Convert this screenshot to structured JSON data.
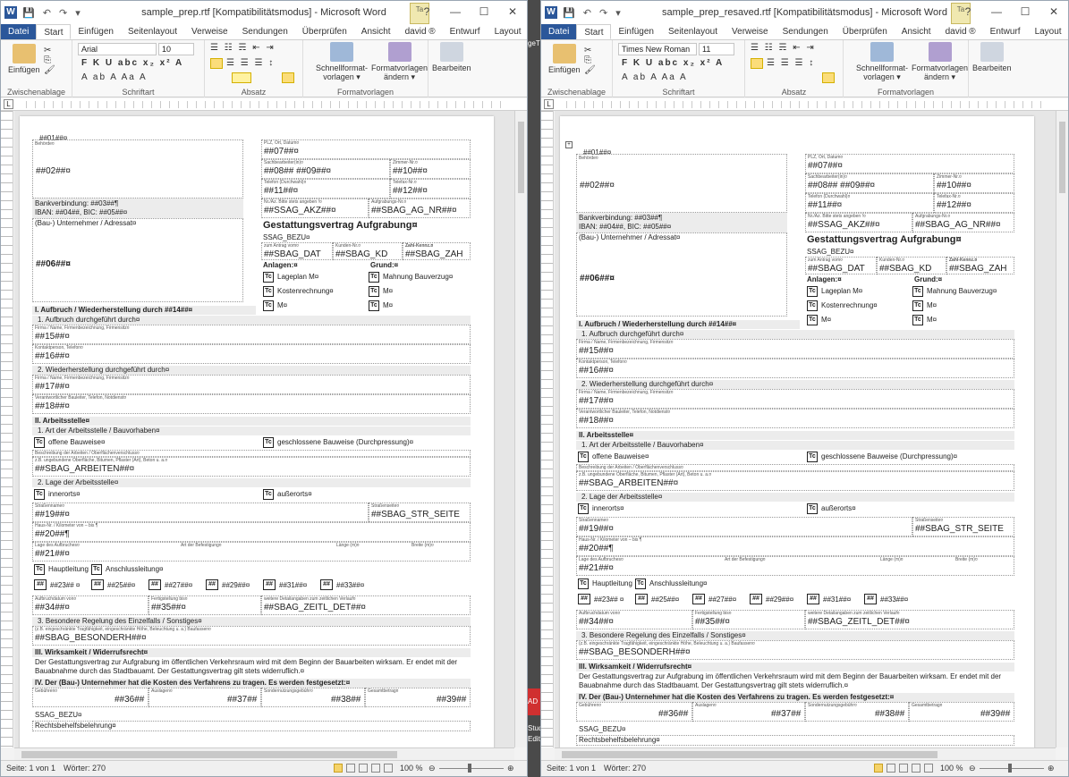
{
  "left": {
    "title": "sample_prep.rtf [Kompatibilitätsmodus]  -  Microsoft Word",
    "font_name": "Arial",
    "font_size": "10",
    "zoom": "100 %"
  },
  "right": {
    "title": "sample_prep_resaved.rtf [Kompatibilitätsmodus]  -  Microsoft Word",
    "font_name": "Times New Roman",
    "font_size": "11",
    "zoom": "100 %"
  },
  "ribbon": {
    "tabs": [
      "Datei",
      "Start",
      "Einfügen",
      "Seitenlayout",
      "Verweise",
      "Sendungen",
      "Überprüfen",
      "Ansicht",
      "david ®",
      "Entwurf",
      "Layout"
    ],
    "paste": "Einfügen",
    "styles_quick": "Schnellformat-\nvorlagen ▾",
    "styles_change": "Formatvorlagen\nändern ▾",
    "edit": "Bearbeiten",
    "groups": {
      "clipboard": "Zwischenablage",
      "font": "Schriftart",
      "paragraph": "Absatz",
      "styles": "Formatvorlagen"
    },
    "context_tab": "Ta"
  },
  "status": {
    "page": "Seite: 1 von 1",
    "words": "Wörter: 270"
  },
  "gap_text": [
    "geTr",
    "AD",
    "Stud",
    "Edit"
  ],
  "doc": {
    "behoerde": "Behörde¤",
    "f02": "##02##¤",
    "plz": "PLZ, Ort, Datum¤",
    "f07": "##07##¤",
    "sachb": "Sachbearbeiter(in)¤",
    "zimmer": "Zimmer-Nr.¤",
    "f08": "##08## ##09##¤",
    "f10": "##10##¤",
    "tel": "Telefon (Durchwahl)¤",
    "fax": "Telefax-Nr.¤",
    "f11": "##11##¤",
    "f12": "##12##¤",
    "nrakz": "Nr./Az. Bitte stets angeben !¤",
    "aufgnr": "Aufgrabungs-Nr.¤",
    "akz": "##SSAG_AKZ##¤",
    "agnr": "##SBAG_AG_NR##¤",
    "bank": "Bankverbindung: ##03##¶",
    "iban": "IBAN: ##04##, BIC: ##05##¤",
    "unternehmer": "(Bau-) Unternehmer / Adressat¤",
    "f06": "##06##¤",
    "vertrag": "Gestattungsvertrag Aufgrabung¤",
    "bezu": "SSAG_BEZU¤",
    "antrag": "zum Antrag vom¤",
    "kunde": "Kunden-Nr.¤",
    "zahl": "Zahl-Kennz.¤",
    "sdat": "##SBAG_DAT",
    "skd": "##SBAG_KD",
    "szah": "##SBAG_ZAH",
    "anlagen": "Anlagen:¤",
    "grund": "Grund:¤",
    "lageplan": "Lageplan M¤",
    "mahnung": "Mahnung Bauverzug¤",
    "kosten": "Kostenrechnung¤",
    "m": "M¤",
    "s1": "I. Aufbruch / Wiederherstellung durch ##14##¤",
    "s1a": "1. Aufbruch durchgeführt durch¤",
    "firma": "Firma / Name, Firmenbezeichnung, Firmensitz¤",
    "f15": "##15##¤",
    "kontakt": "Kontaktperson, Telefon¤",
    "f16": "##16##¤",
    "s1b": "2. Wiederherstellung durchgeführt durch¤",
    "f17": "##17##¤",
    "verantw": "Verantwortlicher Bauleiter, Telefon, Notdienst¤",
    "f18": "##18##¤",
    "s2": "II. Arbeitsstelle¤",
    "s2a": "1. Art der Arbeitsstelle / Bauvorhaben¤",
    "offen": "offene Bauweise¤",
    "geschl": "geschlossene Bauweise (Durchpressung)¤",
    "beschr": "Beschreibung der Arbeiten / Oberflächenverschluss¤",
    "zb": "z.B. ungebundene Oberfläche, Bitumen, Pflaster (Art), Beton u. a.¤",
    "arbeiten": "##SBAG_ARBEITEN##¤",
    "s2b": "2. Lage der Arbeitsstelle¤",
    "innerorts": "innerorts¤",
    "ausserorts": "außerorts¤",
    "strname": "Straßenname¤",
    "strseite": "Straßenseite¤",
    "f19": "##19##¤",
    "strs": "##SBAG_STR_SEITE",
    "hausnr": "Haus-Nr. / Kilometer von – bis ¶",
    "f20": "##20##¶",
    "lage": "Lage des Aufbruches¤",
    "artbef": "Art der Befestigung¤",
    "laenge": "Länge (m)¤",
    "breite": "Breite (m)¤",
    "f21": "##21##¤",
    "haupt": "Hauptleitung",
    "ansch": "Anschlussleitung¤",
    "nums": [
      "##23## ¤",
      "##25##¤",
      "##27##¤",
      "##29##¤",
      "##31##¤",
      "##33##¤"
    ],
    "aufbruch": "Aufbruchdatum von¤",
    "fertig": "Fertigstellung bis¤",
    "weitere": "weitere Detailangaben zum zeitlichen Verlauf¤",
    "f34": "##34##¤",
    "f35": "##35##¤",
    "zeitl": "##SBAG_ZEITL_DET##¤",
    "s3": "3. Besondere Regelung des Einzelfalls / Sonstiges¤",
    "zb2": "(z.B. eingeschränkte Tragfähigkeit, eingeschränkte Höhe, Beleuchtung u. a.) Baufassen¤",
    "besond": "##SBAG_BESONDERH##¤",
    "s4": "III. Wirksamkeit / Widerrufsrecht¤",
    "wirk1": "Der Gestattungsvertrag zur Aufgrabung im öffentlichen Verkehrsraum wird mit dem Beginn der Bauarbeiten wirksam. Er endet mit der",
    "wirk2": "Bauabnahme durch das Stadtbauamt. Der Gestattungsvertrag gilt stets widerruflich.¤",
    "s5": "IV. Der (Bau-) Unternehmer hat die Kosten des Verfahrens zu tragen. Es werden festgesetzt:¤",
    "geb": "Gebühren¤",
    "ausl": "Auslagen¤",
    "sonder": "Sondernutzungsgebühr¤",
    "ges": "Gesamtbetrag¤",
    "f36": "##36##",
    "f37": "##37##",
    "f38": "##38##",
    "f39": "##39##",
    "rechts": "Rechtsbehelfsbelehrung¤",
    "hdr": "##01##¤",
    "td": "Tc",
    "hash": "##"
  }
}
